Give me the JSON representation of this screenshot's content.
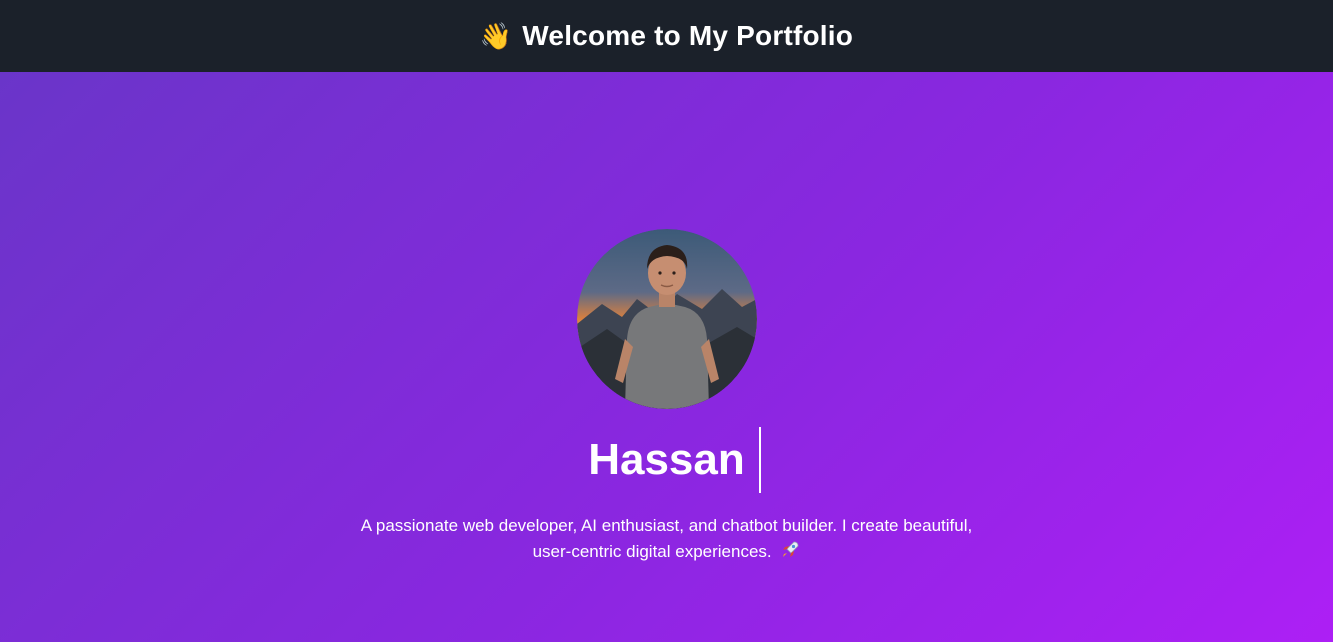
{
  "header": {
    "title": "Welcome to My Portfolio",
    "icon": "waving-hand-icon",
    "icon_glyph": "👋",
    "background": "#1b212a"
  },
  "hero": {
    "background_start": "#6a35c9",
    "background_end": "#ad1ff5",
    "avatar": "profile-photo",
    "name": "Hassan",
    "tagline": "A passionate web developer, AI enthusiast, and chatbot builder. I create beautiful, user-centric digital experiences.",
    "tagline_icon": "rocket-icon"
  }
}
